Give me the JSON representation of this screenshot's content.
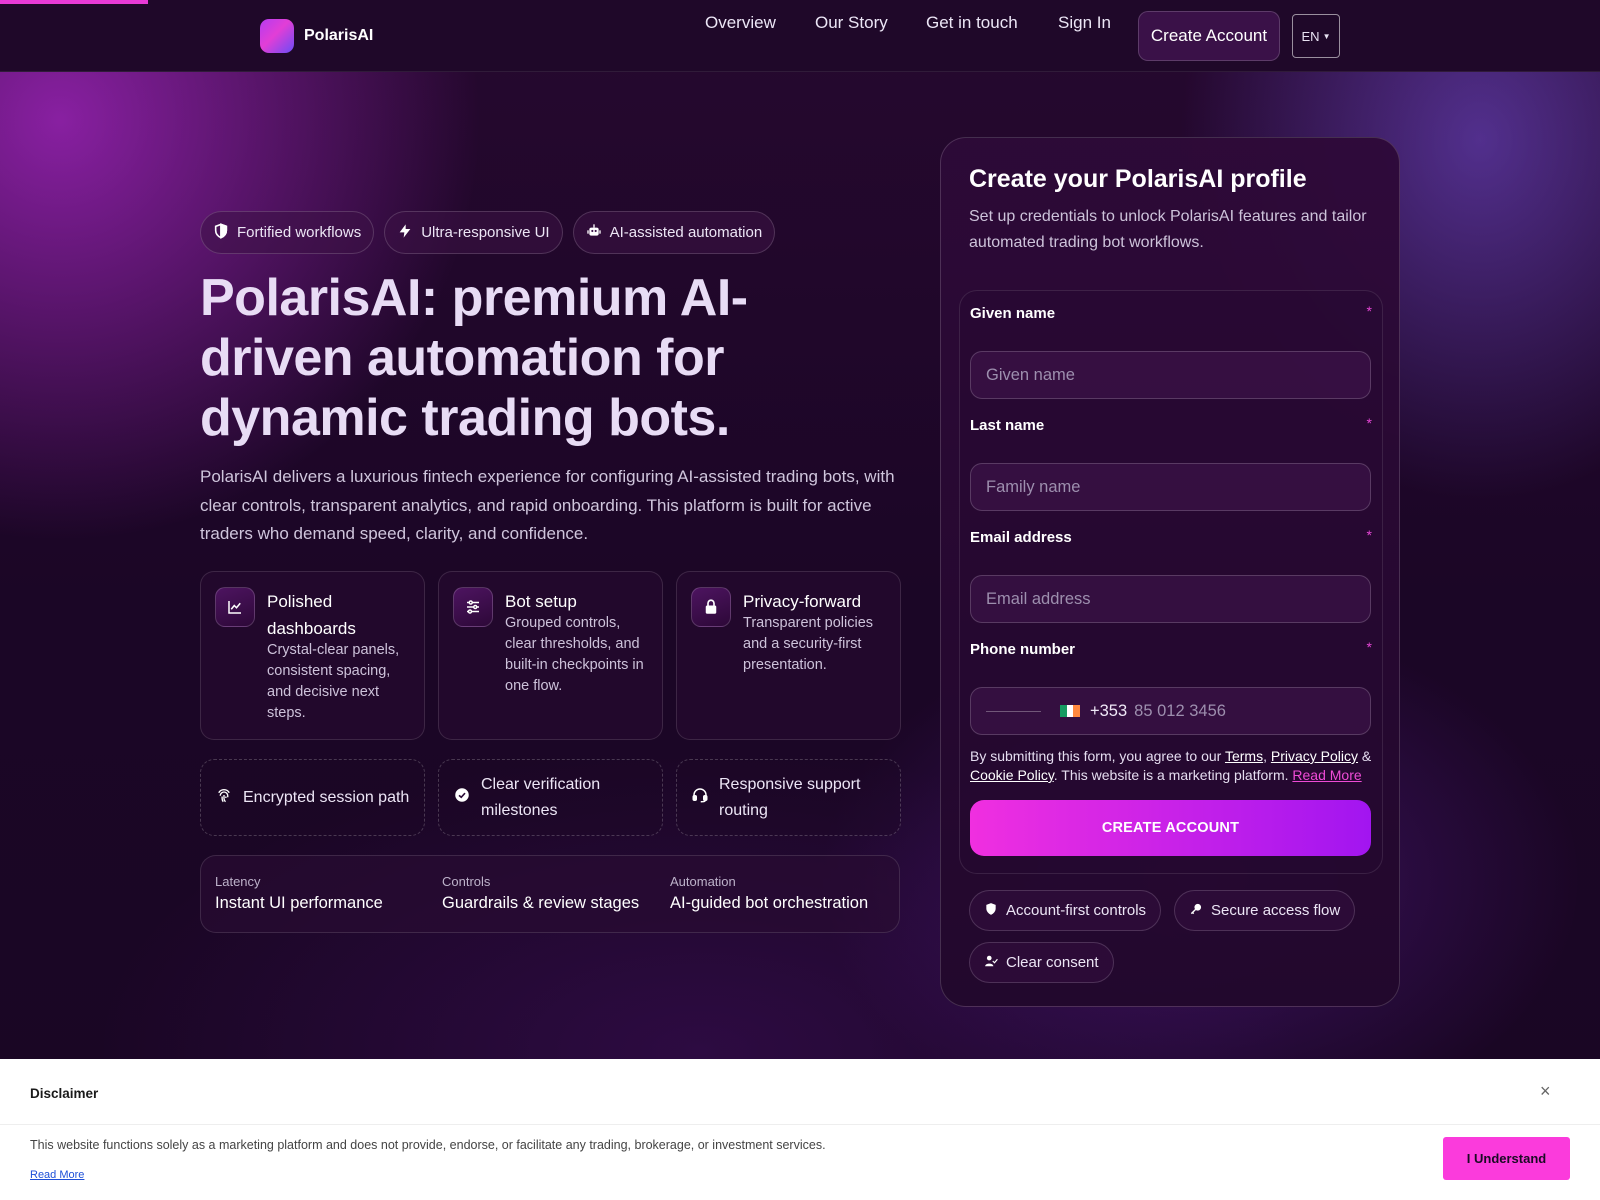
{
  "brand": {
    "name": "PolarisAI"
  },
  "nav": {
    "overview": "Overview",
    "our_story": "Our Story",
    "get_in_touch": "Get in touch",
    "sign_in": "Sign In",
    "create_account": "Create Account",
    "language": "EN"
  },
  "hero": {
    "pills": [
      "Fortified workflows",
      "Ultra-responsive UI",
      "AI-assisted automation"
    ],
    "title": "PolarisAI: premium AI-driven automation for dynamic trading bots.",
    "description": "PolarisAI delivers a luxurious fintech experience for configuring AI-assisted trading bots, with clear controls, transparent analytics, and rapid onboarding. This platform is built for active traders who demand speed, clarity, and confidence."
  },
  "features": [
    {
      "title": "Polished dashboards",
      "desc": "Crystal-clear panels, consistent spacing, and decisive next steps.",
      "icon": "chart-line-icon"
    },
    {
      "title": "Bot setup",
      "desc": "Grouped controls, clear thresholds, and built-in checkpoints in one flow.",
      "icon": "sliders-icon"
    },
    {
      "title": "Privacy-forward",
      "desc": "Transparent policies and a security-first presentation.",
      "icon": "lock-icon"
    }
  ],
  "highlights": [
    {
      "text": "Encrypted session path",
      "icon": "fingerprint-icon"
    },
    {
      "text": "Clear verification milestones",
      "icon": "check-circle-icon"
    },
    {
      "text": "Responsive support routing",
      "icon": "headset-icon"
    }
  ],
  "stats": [
    {
      "label": "Latency",
      "value": "Instant UI performance"
    },
    {
      "label": "Controls",
      "value": "Guardrails & review stages"
    },
    {
      "label": "Automation",
      "value": "AI-guided bot orchestration"
    }
  ],
  "form": {
    "title": "Create your PolarisAI profile",
    "subtitle": "Set up credentials to unlock PolarisAI features and tailor automated trading bot workflows.",
    "given_name_label": "Given name",
    "given_name_placeholder": "Given name",
    "last_name_label": "Last name",
    "last_name_placeholder": "Family name",
    "email_label": "Email address",
    "email_placeholder": "Email address",
    "phone_label": "Phone number",
    "phone_dial_code": "+353",
    "phone_placeholder": "85 012 3456",
    "required_mark": "*",
    "consent_prefix": "By submitting this form, you agree to our",
    "terms": "Terms",
    "privacy": "Privacy Policy",
    "amp": "&",
    "cookie": "Cookie Policy",
    "consent_suffix": ". This website is a marketing platform.",
    "read_more": "Read More",
    "submit": "CREATE ACCOUNT",
    "chips": [
      "Account-first controls",
      "Secure access flow",
      "Clear consent"
    ]
  },
  "disclaimer": {
    "title": "Disclaimer",
    "close": "×",
    "text": "This website functions solely as a marketing platform and does not provide, endorse, or facilitate any trading, brokerage, or investment services.",
    "read_more": "Read More",
    "button": "I Understand"
  },
  "colors": {
    "accent": "#f02fe0",
    "accent_end": "#a215f0",
    "background": "#1b0626",
    "disclaimer_button": "#fb3bdc"
  }
}
